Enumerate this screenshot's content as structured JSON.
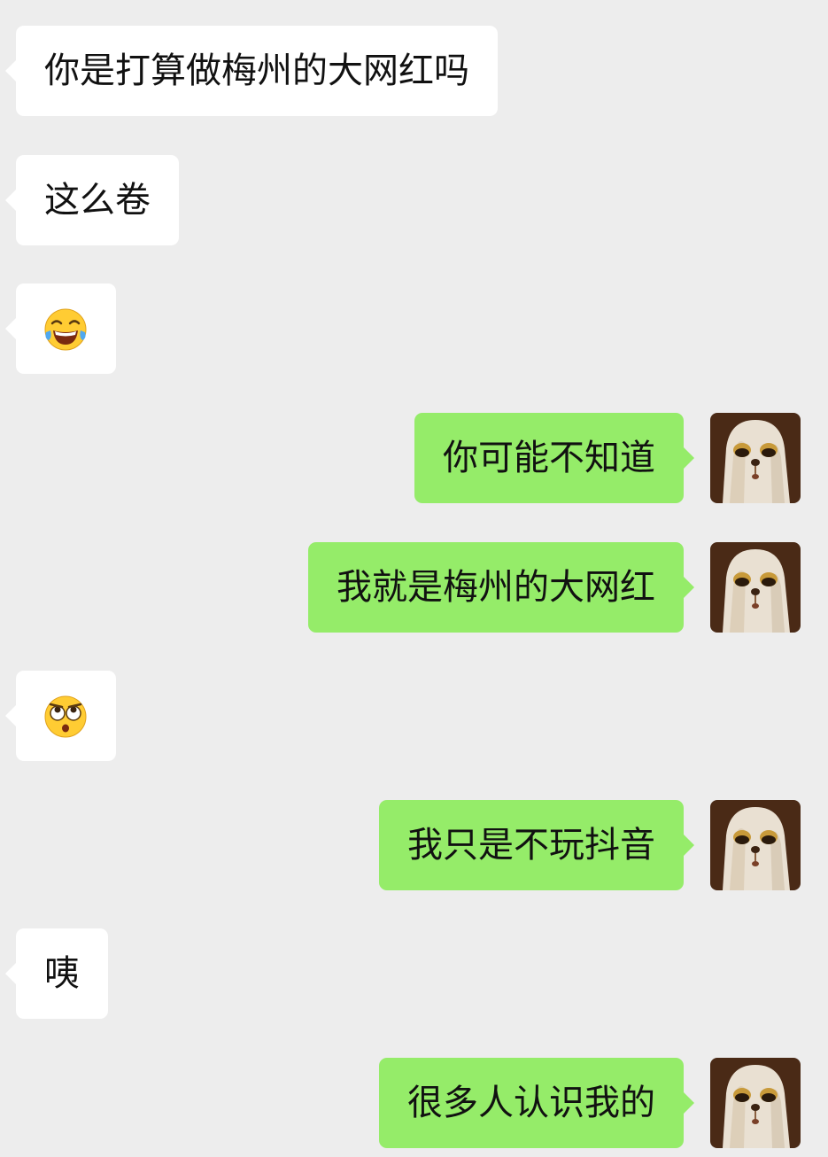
{
  "messages": [
    {
      "side": "in",
      "kind": "text",
      "text": "你是打算做梅州的大网红吗"
    },
    {
      "side": "in",
      "kind": "text",
      "text": "这么卷"
    },
    {
      "side": "in",
      "kind": "emoji",
      "emoji": "tears-of-joy-face"
    },
    {
      "side": "out",
      "kind": "text",
      "text": "你可能不知道",
      "avatar": "ghost-dog-avatar"
    },
    {
      "side": "out",
      "kind": "text",
      "text": "我就是梅州的大网红",
      "avatar": "ghost-dog-avatar"
    },
    {
      "side": "in",
      "kind": "emoji",
      "emoji": "rolling-eyes-shocked-face"
    },
    {
      "side": "out",
      "kind": "text",
      "text": "我只是不玩抖音",
      "avatar": "ghost-dog-avatar"
    },
    {
      "side": "in",
      "kind": "text",
      "text": "咦"
    },
    {
      "side": "out",
      "kind": "text",
      "text": "很多人认识我的",
      "avatar": "ghost-dog-avatar"
    }
  ],
  "colors": {
    "background": "#ededed",
    "incoming_bubble": "#ffffff",
    "outgoing_bubble": "#95ec69",
    "text": "#111111"
  }
}
